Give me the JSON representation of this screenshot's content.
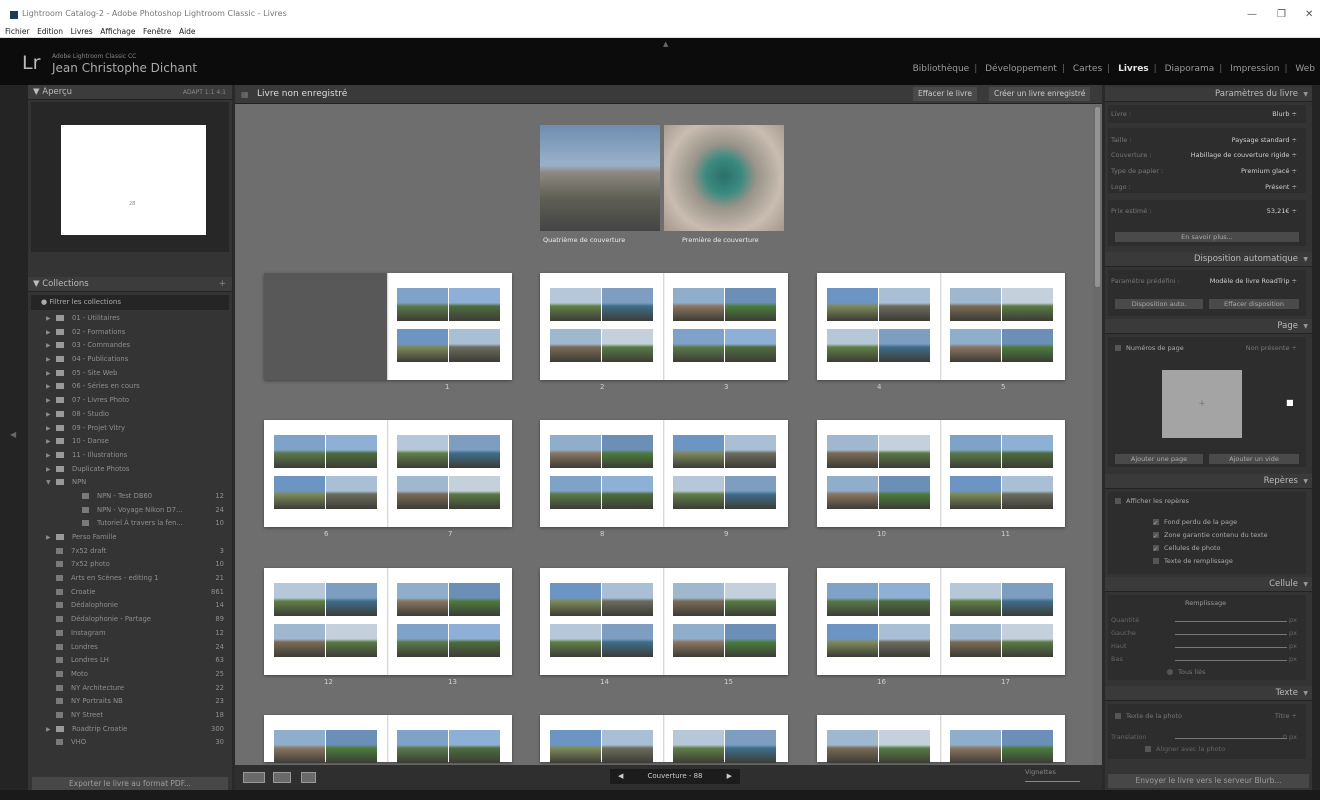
{
  "window": {
    "title": "Lightroom Catalog-2 - Adobe Photoshop Lightroom Classic - Livres",
    "minimize": "—",
    "restore": "❐",
    "close": "✕"
  },
  "menubar": [
    "Fichier",
    "Edition",
    "Livres",
    "Affichage",
    "Fenêtre",
    "Aide"
  ],
  "identity": {
    "logo": "Lr",
    "product": "Adobe Lightroom Classic CC",
    "user": "Jean Christophe Dichant",
    "up_arrow": "▲"
  },
  "modules": [
    "Bibliothèque",
    "Développement",
    "Cartes",
    "Livres",
    "Diaporama",
    "Impression",
    "Web"
  ],
  "left_panel": {
    "apercu": {
      "title": "Aperçu",
      "controls": "ADAPT   1:1   4:1",
      "page_num": "28"
    },
    "collections": {
      "title": "Collections",
      "add": "+",
      "filter": "Filtrer les collections",
      "items": [
        {
          "name": "01 - Utilitaires",
          "count": "",
          "level": 1,
          "set": true
        },
        {
          "name": "02 - Formations",
          "count": "",
          "level": 1,
          "set": true
        },
        {
          "name": "03 - Commandes",
          "count": "",
          "level": 1,
          "set": true
        },
        {
          "name": "04 - Publications",
          "count": "",
          "level": 1,
          "set": true
        },
        {
          "name": "05 - Site Web",
          "count": "",
          "level": 1,
          "set": true
        },
        {
          "name": "06 - Séries en cours",
          "count": "",
          "level": 1,
          "set": true
        },
        {
          "name": "07 - Livres Photo",
          "count": "",
          "level": 1,
          "set": true
        },
        {
          "name": "08 - Studio",
          "count": "",
          "level": 1,
          "set": true
        },
        {
          "name": "09 - Projet Vitry",
          "count": "",
          "level": 1,
          "set": true
        },
        {
          "name": "10 - Danse",
          "count": "",
          "level": 1,
          "set": true
        },
        {
          "name": "11 - Illustrations",
          "count": "",
          "level": 1,
          "set": true
        },
        {
          "name": "Duplicate Photos",
          "count": "",
          "level": 1,
          "set": true
        },
        {
          "name": "NPN",
          "count": "",
          "level": 1,
          "set": true,
          "open": true
        },
        {
          "name": "NPN - Test DB60",
          "count": "12",
          "level": 2,
          "set": false
        },
        {
          "name": "NPN - Voyage Nikon D7...",
          "count": "24",
          "level": 2,
          "set": false
        },
        {
          "name": "Tutoriel À travers la fen...",
          "count": "10",
          "level": 2,
          "set": false
        },
        {
          "name": "Perso Famille",
          "count": "",
          "level": 1,
          "set": true
        },
        {
          "name": "7x52 draft",
          "count": "3",
          "level": 1,
          "set": false
        },
        {
          "name": "7x52 photo",
          "count": "10",
          "level": 1,
          "set": false
        },
        {
          "name": "Arts en Scènes - editing 1",
          "count": "21",
          "level": 1,
          "set": false
        },
        {
          "name": "Croatie",
          "count": "861",
          "level": 1,
          "set": false
        },
        {
          "name": "Dédalophonie",
          "count": "14",
          "level": 1,
          "set": false
        },
        {
          "name": "Dédalophonie - Partage",
          "count": "89",
          "level": 1,
          "set": false
        },
        {
          "name": "Instagram",
          "count": "12",
          "level": 1,
          "set": false
        },
        {
          "name": "Londres",
          "count": "24",
          "level": 1,
          "set": false
        },
        {
          "name": "Londres LH",
          "count": "63",
          "level": 1,
          "set": false
        },
        {
          "name": "Moto",
          "count": "25",
          "level": 1,
          "set": false
        },
        {
          "name": "NY Architecture",
          "count": "22",
          "level": 1,
          "set": false
        },
        {
          "name": "NY Portraits NB",
          "count": "23",
          "level": 1,
          "set": false
        },
        {
          "name": "NY Street",
          "count": "18",
          "level": 1,
          "set": false
        },
        {
          "name": "Roadtrip Croatie",
          "count": "300",
          "level": 1,
          "set": true
        },
        {
          "name": "VHO",
          "count": "30",
          "level": 1,
          "set": false
        }
      ]
    },
    "export_button": "Exporter le livre au format PDF..."
  },
  "main": {
    "title": "Livre non enregistré",
    "clear_button": "Effacer le livre",
    "create_button": "Créer un livre enregistré",
    "cover_back_label": "Quatrième de couverture",
    "cover_front_label": "Première de couverture",
    "page_numbers": [
      "1",
      "2",
      "3",
      "4",
      "5",
      "6",
      "7",
      "8",
      "9",
      "10",
      "11",
      "12",
      "13",
      "14",
      "15",
      "16",
      "17"
    ],
    "nav_label": "Couverture - 88",
    "nav_prev": "◀",
    "nav_next": "▶",
    "vignettes_label": "Vignettes"
  },
  "right_panel": {
    "book_settings": {
      "title": "Paramètres du livre",
      "livre_label": "Livre :",
      "livre_value": "Blurb ÷",
      "taille_label": "Taille :",
      "taille_value": "Paysage standard ÷",
      "couverture_label": "Couverture :",
      "couverture_value": "Habillage de couverture rigide ÷",
      "papier_label": "Type de papier :",
      "papier_value": "Premium glacé ÷",
      "logo_label": "Logo :",
      "logo_value": "Présent ÷",
      "prix_label": "Prix estimé :",
      "prix_value": "53,21€ ÷",
      "more_button": "En savoir plus..."
    },
    "auto_layout": {
      "title": "Disposition automatique",
      "preset_label": "Paramètre prédéfini :",
      "preset_value": "Modèle de livre RoadTrip ÷",
      "auto_button": "Disposition auto.",
      "clear_button": "Effacer disposition"
    },
    "page": {
      "title": "Page",
      "page_numbers": "Numéros de page",
      "page_numbers_value": "Non présente ÷",
      "add_page": "Ajouter une page",
      "add_blank": "Ajouter un vide",
      "plus": "+",
      "black_marker": "■"
    },
    "guides": {
      "title": "Repères",
      "show_guides": "Afficher les repères",
      "items": [
        "Fond perdu de la page",
        "Zone garantie contenu du texte",
        "Cellules de photo",
        "Texte de remplissage"
      ]
    },
    "cell": {
      "title": "Cellule",
      "fill_label": "Remplissage",
      "rows": [
        {
          "label": "Quantité",
          "value": "px"
        },
        {
          "label": "Gauche",
          "value": "px"
        },
        {
          "label": "Haut",
          "value": "px"
        },
        {
          "label": "Bas",
          "value": "px"
        }
      ],
      "link_all": "Tous liés"
    },
    "text": {
      "title": "Texte",
      "photo_text": "Texte de la photo",
      "photo_text_value": "Titre ÷",
      "offset_label": "Translation",
      "offset_value": "0 px",
      "align": "Aligner avec la photo"
    },
    "send_button": "Envoyer le livre vers le serveur Blurb..."
  },
  "colors": {
    "module_active": "#e8e8e8",
    "panel": "#343434",
    "canvas": "#6e6e6e",
    "identity": "#0c0c0c"
  }
}
